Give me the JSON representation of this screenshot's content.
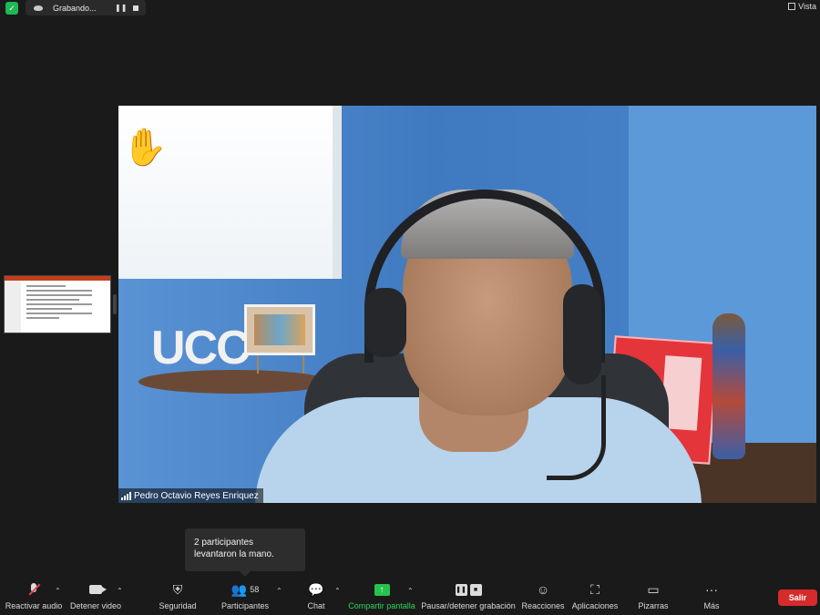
{
  "top_bar": {
    "recording_label": "Grabando...",
    "pause_icon": "pause-icon",
    "view_label": "Vista"
  },
  "main_video": {
    "participant_name": "Pedro Octavio Reyes Enriquez",
    "background_sign_text": "UCC",
    "reaction_emoji": "✋"
  },
  "tooltip": {
    "text": "2 participantes levantaron la mano."
  },
  "toolbar": {
    "unmute_label": "Reactivar audio",
    "stop_video_label": "Detener video",
    "security_label": "Seguridad",
    "participants_label": "Participantes",
    "participants_count": "58",
    "chat_label": "Chat",
    "share_label": "Compartir pantalla",
    "pause_record_label": "Pausar/detener grabación",
    "reactions_label": "Reacciones",
    "apps_label": "Aplicaciones",
    "whiteboards_label": "Pizarras",
    "more_label": "Más",
    "more_glyph": "···",
    "exit_label": "Salir"
  },
  "colors": {
    "background": "#1a1a1a",
    "share_accent": "#2fd35b",
    "exit_red": "#d62b2b",
    "security_green": "#1db954"
  }
}
